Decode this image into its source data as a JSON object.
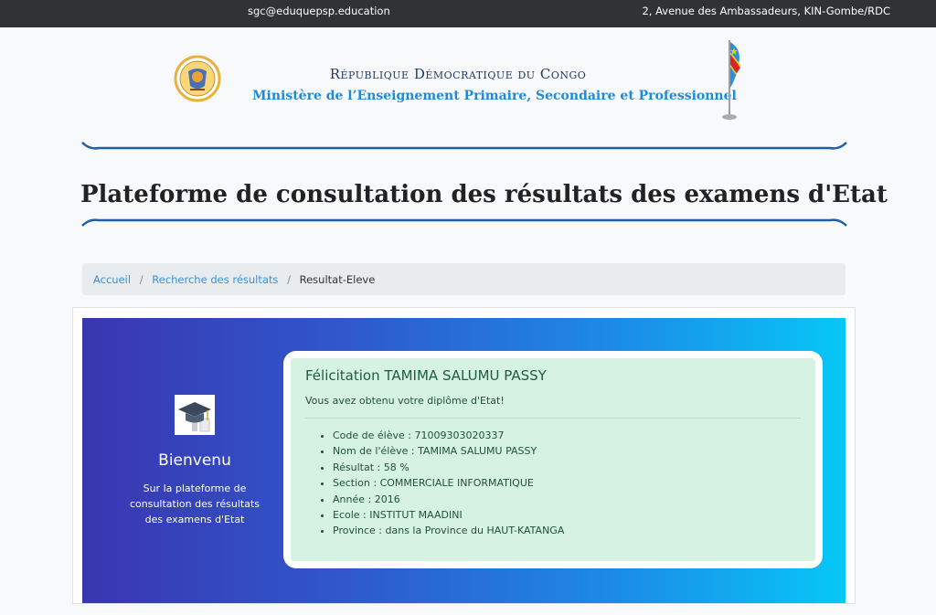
{
  "topbar": {
    "email": "sgc@eduquepsp.education",
    "address": "2, Avenue des Ambassadeurs, KIN-Gombe/RDC"
  },
  "header": {
    "country": "République Démocratique du Congo",
    "ministry": "Ministère de l’Enseignement Primaire, Secondaire et Professionnel"
  },
  "page_title": "Plateforme de consultation des résultats des examens d'Etat",
  "breadcrumb": {
    "items": [
      "Accueil",
      "Recherche des résultats",
      "Resultat-Eleve"
    ],
    "separator": "/"
  },
  "welcome": {
    "icon": "graduation-cap-icon",
    "title": "Bienvenu",
    "text": "Sur la plateforme de consultation des résultats des examens d'Etat"
  },
  "result": {
    "heading": "Félicitation TAMIMA SALUMU PASSY",
    "message": "Vous avez obtenu votre diplôme d'Etat!",
    "details": [
      "Code de élève : 71009303020337",
      "Nom de l'élève : TAMIMA SALUMU PASSY",
      "Résultat : 58 %",
      "Section : COMMERCIALE INFORMATIQUE",
      "Année : 2016",
      "Ecole : INSTITUT MAADINI",
      "Province : dans la Province du HAUT-KATANGA"
    ]
  },
  "colors": {
    "topbar": "#2f3336",
    "accent_blue": "#1f8ad6",
    "success_bg": "#d5f2e2",
    "gradient_start": "#3a36b0",
    "gradient_end": "#07c7f6"
  }
}
